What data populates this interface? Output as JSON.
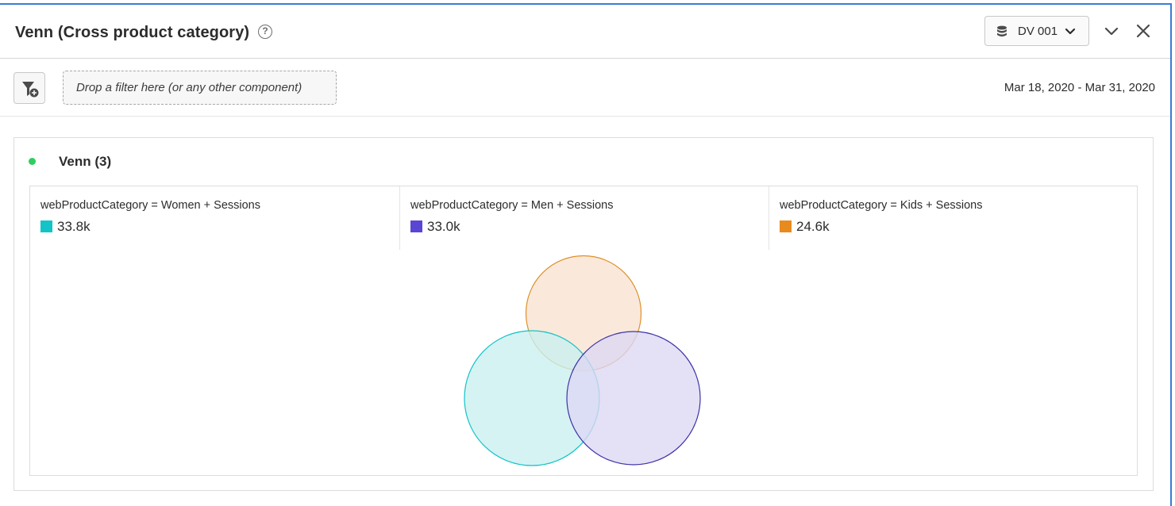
{
  "panel": {
    "title": "Venn (Cross product category)",
    "help_glyph": "?",
    "data_view": "DV 001",
    "icons": {
      "help": "help-circle-icon",
      "data_view": "database-icon",
      "data_view_menu": "chevron-down-icon",
      "collapse": "chevron-down-icon",
      "close": "close-icon"
    }
  },
  "filter_bar": {
    "drop_placeholder": "Drop a filter here (or any other component)",
    "date_range": "Mar 18, 2020 - Mar 31, 2020",
    "icons": {
      "add_filter": "filter-add-icon"
    }
  },
  "visualization": {
    "title": "Venn (3)",
    "status_color": "#2dce5f",
    "legend": [
      {
        "label": "webProductCategory = Women + Sessions",
        "value": "33.8k",
        "color": "#12c3c8"
      },
      {
        "label": "webProductCategory = Men + Sessions",
        "value": "33.0k",
        "color": "#5a46d4"
      },
      {
        "label": "webProductCategory = Kids + Sessions",
        "value": "24.6k",
        "color": "#e88a1e"
      }
    ]
  },
  "chart_data": {
    "type": "venn",
    "sets": [
      {
        "name": "webProductCategory = Women + Sessions",
        "value": 33800,
        "display": "33.8k",
        "stroke": "#12c3c8",
        "fill": "#c9f0f0"
      },
      {
        "name": "webProductCategory = Men + Sessions",
        "value": 33000,
        "display": "33.0k",
        "stroke": "#3f34a8",
        "fill": "#dcd7f4"
      },
      {
        "name": "webProductCategory = Kids + Sessions",
        "value": 24600,
        "display": "24.6k",
        "stroke": "#e08f2a",
        "fill": "#f9e3d1"
      }
    ]
  }
}
